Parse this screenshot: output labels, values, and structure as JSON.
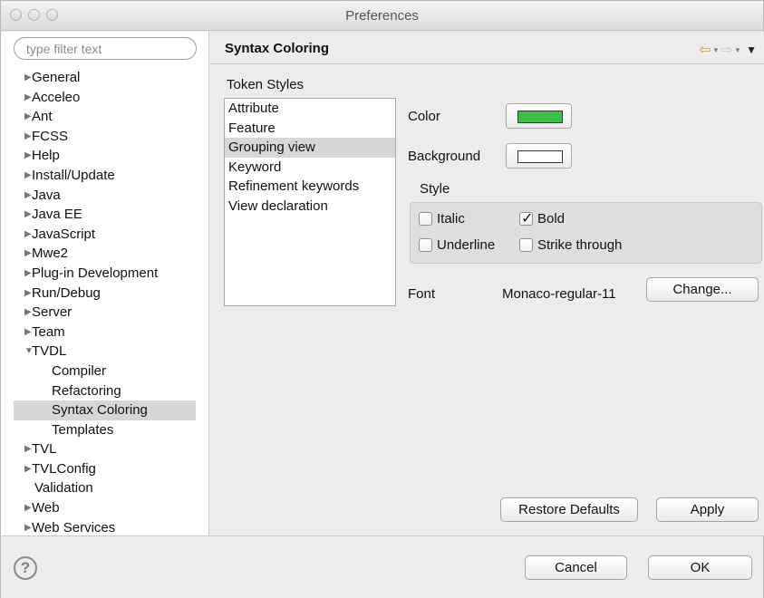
{
  "window": {
    "title": "Preferences"
  },
  "filter": {
    "placeholder": "type filter text"
  },
  "tree": [
    {
      "label": "General",
      "type": "collapsed"
    },
    {
      "label": "Acceleo",
      "type": "collapsed"
    },
    {
      "label": "Ant",
      "type": "collapsed"
    },
    {
      "label": "FCSS",
      "type": "collapsed"
    },
    {
      "label": "Help",
      "type": "collapsed"
    },
    {
      "label": "Install/Update",
      "type": "collapsed"
    },
    {
      "label": "Java",
      "type": "collapsed"
    },
    {
      "label": "Java EE",
      "type": "collapsed"
    },
    {
      "label": "JavaScript",
      "type": "collapsed"
    },
    {
      "label": "Mwe2",
      "type": "collapsed"
    },
    {
      "label": "Plug-in Development",
      "type": "collapsed"
    },
    {
      "label": "Run/Debug",
      "type": "collapsed"
    },
    {
      "label": "Server",
      "type": "collapsed"
    },
    {
      "label": "Team",
      "type": "collapsed"
    },
    {
      "label": "TVDL",
      "type": "expanded"
    },
    {
      "label": "Compiler",
      "type": "child"
    },
    {
      "label": "Refactoring",
      "type": "child"
    },
    {
      "label": "Syntax Coloring",
      "type": "child",
      "selected": true
    },
    {
      "label": "Templates",
      "type": "child"
    },
    {
      "label": "TVL",
      "type": "collapsed"
    },
    {
      "label": "TVLConfig",
      "type": "collapsed"
    },
    {
      "label": "Validation",
      "type": "leaf"
    },
    {
      "label": "Web",
      "type": "collapsed"
    },
    {
      "label": "Web Services",
      "type": "collapsed"
    }
  ],
  "page": {
    "title": "Syntax Coloring"
  },
  "tokens": {
    "label": "Token Styles",
    "items": [
      "Attribute",
      "Feature",
      "Grouping view",
      "Keyword",
      "Refinement keywords",
      "View declaration"
    ],
    "selected_index": 2
  },
  "color": {
    "label": "Color",
    "value": "#3dbf4a"
  },
  "background": {
    "label": "Background",
    "value": "#ffffff"
  },
  "style": {
    "title": "Style",
    "italic": {
      "label": "Italic",
      "checked": false
    },
    "bold": {
      "label": "Bold",
      "checked": true
    },
    "underline": {
      "label": "Underline",
      "checked": false
    },
    "strike": {
      "label": "Strike through",
      "checked": false
    }
  },
  "font": {
    "label": "Font",
    "value": "Monaco-regular-11",
    "change_label": "Change..."
  },
  "actions": {
    "restore_label": "Restore Defaults",
    "apply_label": "Apply"
  },
  "footer": {
    "cancel_label": "Cancel",
    "ok_label": "OK"
  }
}
